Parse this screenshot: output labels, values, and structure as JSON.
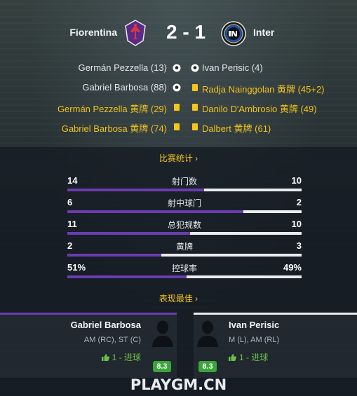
{
  "match": {
    "home_team": "Fiorentina",
    "away_team": "Inter",
    "score": "2 - 1"
  },
  "events": [
    {
      "left": "Germán Pezzella (13)",
      "left_type": "goal",
      "right": "Ivan Perisic (4)",
      "right_type": "goal"
    },
    {
      "left": "Gabriel Barbosa (88)",
      "left_type": "goal",
      "right": "Radja Nainggolan 黄牌 (45+2)",
      "right_type": "yellow-card"
    },
    {
      "left": "Germán Pezzella 黄牌 (29)",
      "left_type": "yellow-card",
      "right": "Danilo D'Ambrosio 黄牌 (49)",
      "right_type": "yellow-card"
    },
    {
      "left": "Gabriel Barbosa 黄牌 (74)",
      "left_type": "yellow-card",
      "right": "Dalbert 黄牌 (61)",
      "right_type": "yellow-card"
    }
  ],
  "stats_link": "比赛统计 ›",
  "stats": [
    {
      "label": "射门数",
      "home": "14",
      "away": "10",
      "home_share": 0.583
    },
    {
      "label": "射中球门",
      "home": "6",
      "away": "2",
      "home_share": 0.75
    },
    {
      "label": "总犯规数",
      "home": "11",
      "away": "10",
      "home_share": 0.524
    },
    {
      "label": "黄牌",
      "home": "2",
      "away": "3",
      "home_share": 0.4
    },
    {
      "label": "控球率",
      "home": "51%",
      "away": "49%",
      "home_share": 0.51
    }
  ],
  "best_link": "表现最佳 ›",
  "best_players": {
    "home": {
      "name": "Gabriel Barbosa",
      "positions": "AM (RC), ST (C)",
      "goals": "1 - 进球",
      "rating": "8.3"
    },
    "away": {
      "name": "Ivan Perisic",
      "positions": "M (L), AM (RL)",
      "goals": "1 - 进球",
      "rating": "8.3"
    }
  },
  "watermark": "PLAYGM.CN",
  "colors": {
    "home_accent": "#6a3cb0",
    "away_accent": "#e9ecef",
    "link": "#f1c21b",
    "rating": "#3aa53a"
  }
}
